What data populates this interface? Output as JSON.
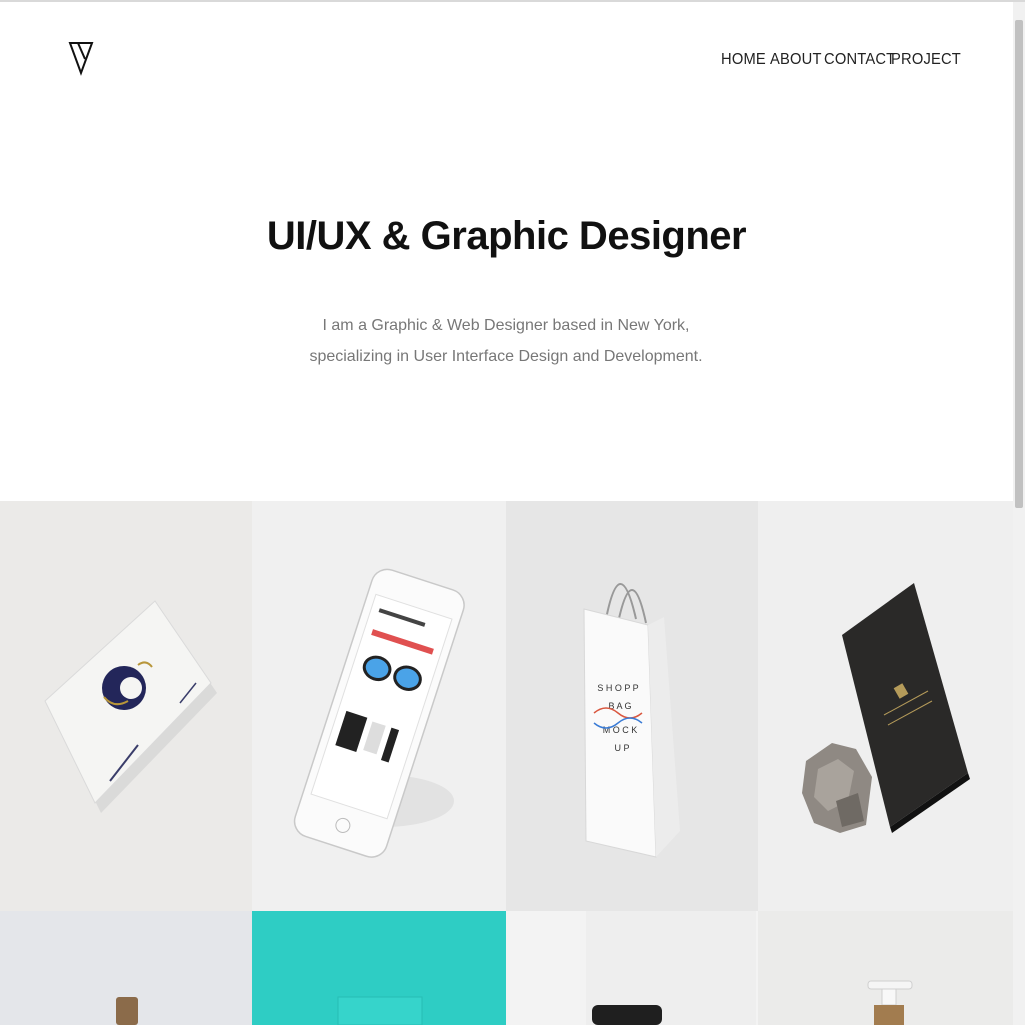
{
  "nav": {
    "home": "HOME",
    "about": "ABOUT",
    "contact": "CONTACT",
    "project": "PROJECT"
  },
  "hero": {
    "title": "UI/UX & Graphic Designer",
    "description": "I am a Graphic & Web Designer based in New York, specializing in User Interface Design and Development."
  },
  "portfolio": {
    "items": [
      {
        "label": "business-card-mockup",
        "color": "#ebeae8"
      },
      {
        "label": "phone-mockup",
        "color": "#f0f0f0"
      },
      {
        "label": "shopping-bag-mockup",
        "color": "#e6e6e6"
      },
      {
        "label": "hardcover-book-mockup",
        "color": "#efefef"
      },
      {
        "label": "bottle-mockup",
        "color": "#e4e6ea"
      },
      {
        "label": "bag-mockup-teal",
        "color": "#2ecdc4"
      },
      {
        "label": "jar-mockup",
        "color": "#f3f3f3"
      },
      {
        "label": "pump-bottle-mockup",
        "color": "#ebebea"
      }
    ]
  }
}
